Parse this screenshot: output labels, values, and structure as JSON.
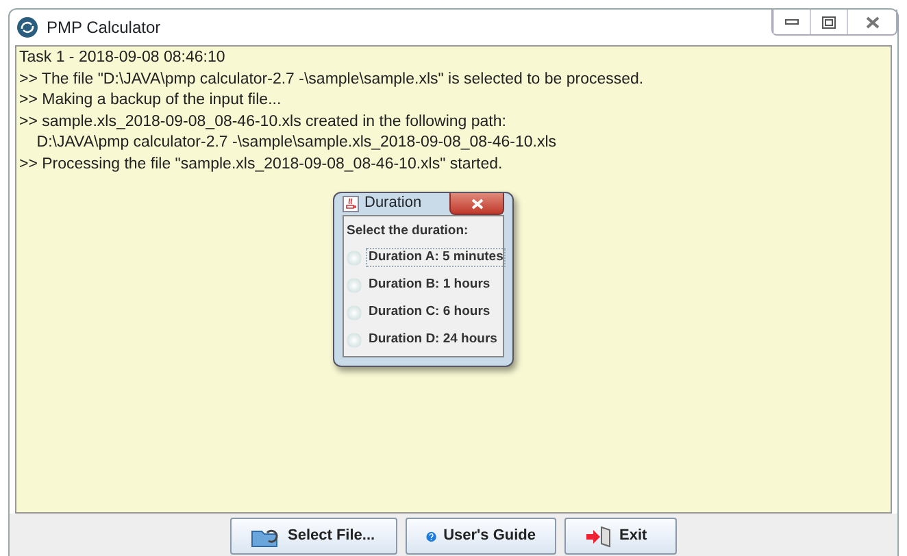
{
  "window": {
    "title": "PMP Calculator"
  },
  "log": [
    "Task 1 - 2018-09-08 08:46:10",
    ">> The file \"D:\\JAVA\\pmp calculator-2.7 -\\sample\\sample.xls\" is selected to be processed.",
    ">> Making a backup of the input file...",
    ">> sample.xls_2018-09-08_08-46-10.xls created in the following path:",
    "    D:\\JAVA\\pmp calculator-2.7 -\\sample\\sample.xls_2018-09-08_08-46-10.xls",
    ">> Processing the file \"sample.xls_2018-09-08_08-46-10.xls\" started."
  ],
  "dialog": {
    "title": "Duration",
    "prompt": "Select the duration:",
    "options": [
      {
        "label": "Duration A: 5 minutes",
        "selected": false,
        "focused": true
      },
      {
        "label": "Duration B: 1 hours",
        "selected": false,
        "focused": false
      },
      {
        "label": "Duration C: 6 hours",
        "selected": false,
        "focused": false
      },
      {
        "label": "Duration D: 24 hours",
        "selected": false,
        "focused": false
      }
    ]
  },
  "buttons": [
    {
      "label": "Select File...",
      "kind": "folder"
    },
    {
      "label": "User's Guide",
      "kind": "help"
    },
    {
      "label": "Exit",
      "kind": "exit"
    }
  ]
}
